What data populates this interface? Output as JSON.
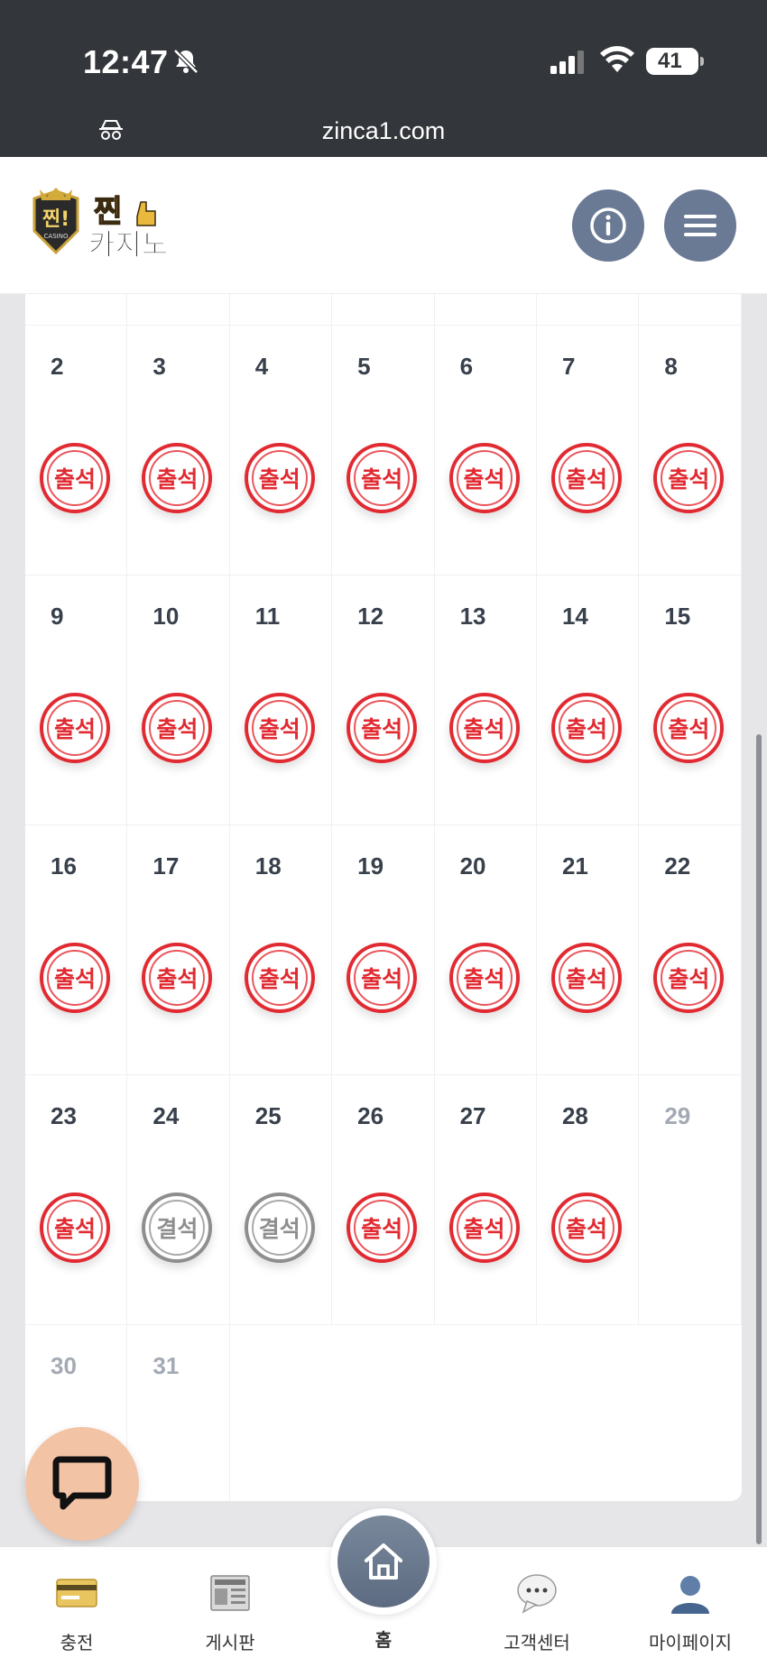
{
  "status_bar": {
    "time": "12:47",
    "battery": "41"
  },
  "browser": {
    "url": "zinca1.com"
  },
  "site": {
    "logo_alt": "찐카지노"
  },
  "calendar": {
    "weeks": [
      [
        {
          "day": "2",
          "stamp": "출석",
          "status": "present"
        },
        {
          "day": "3",
          "stamp": "출석",
          "status": "present"
        },
        {
          "day": "4",
          "stamp": "출석",
          "status": "present"
        },
        {
          "day": "5",
          "stamp": "출석",
          "status": "present"
        },
        {
          "day": "6",
          "stamp": "출석",
          "status": "present"
        },
        {
          "day": "7",
          "stamp": "출석",
          "status": "present"
        },
        {
          "day": "8",
          "stamp": "출석",
          "status": "present"
        }
      ],
      [
        {
          "day": "9",
          "stamp": "출석",
          "status": "present"
        },
        {
          "day": "10",
          "stamp": "출석",
          "status": "present"
        },
        {
          "day": "11",
          "stamp": "출석",
          "status": "present"
        },
        {
          "day": "12",
          "stamp": "출석",
          "status": "present"
        },
        {
          "day": "13",
          "stamp": "출석",
          "status": "present"
        },
        {
          "day": "14",
          "stamp": "출석",
          "status": "present"
        },
        {
          "day": "15",
          "stamp": "출석",
          "status": "present"
        }
      ],
      [
        {
          "day": "16",
          "stamp": "출석",
          "status": "present"
        },
        {
          "day": "17",
          "stamp": "출석",
          "status": "present"
        },
        {
          "day": "18",
          "stamp": "출석",
          "status": "present"
        },
        {
          "day": "19",
          "stamp": "출석",
          "status": "present"
        },
        {
          "day": "20",
          "stamp": "출석",
          "status": "present"
        },
        {
          "day": "21",
          "stamp": "출석",
          "status": "present"
        },
        {
          "day": "22",
          "stamp": "출석",
          "status": "present"
        }
      ],
      [
        {
          "day": "23",
          "stamp": "출석",
          "status": "present"
        },
        {
          "day": "24",
          "stamp": "결석",
          "status": "absent"
        },
        {
          "day": "25",
          "stamp": "결석",
          "status": "absent"
        },
        {
          "day": "26",
          "stamp": "출석",
          "status": "present"
        },
        {
          "day": "27",
          "stamp": "출석",
          "status": "present"
        },
        {
          "day": "28",
          "stamp": "출석",
          "status": "present"
        },
        {
          "day": "29",
          "stamp": "",
          "status": "future"
        }
      ],
      [
        {
          "day": "30",
          "stamp": "",
          "status": "future"
        },
        {
          "day": "31",
          "stamp": "",
          "status": "future"
        }
      ]
    ]
  },
  "bottom_nav": {
    "items": [
      {
        "label": "충전",
        "icon": "credit-card-icon"
      },
      {
        "label": "게시판",
        "icon": "newspaper-icon"
      },
      {
        "label": "홈",
        "icon": "home-icon"
      },
      {
        "label": "고객센터",
        "icon": "chat-bubble-icon"
      },
      {
        "label": "마이페이지",
        "icon": "user-icon"
      }
    ]
  },
  "colors": {
    "present_stamp": "#e12a31",
    "absent_stamp": "#8e8e8e",
    "header_button": "#6a7a94",
    "chat_fab": "#f3c3a5"
  }
}
